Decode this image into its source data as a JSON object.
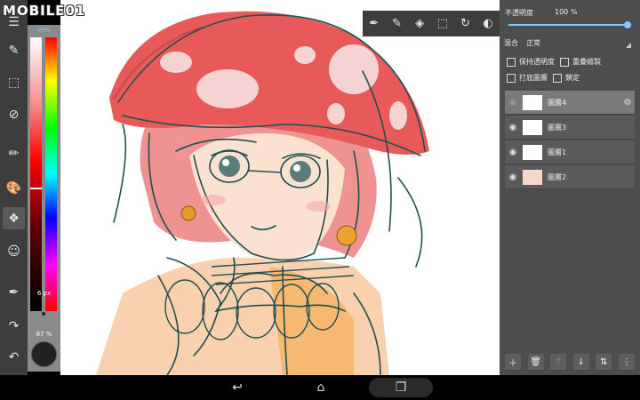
{
  "watermark": {
    "text": "MOBILE01"
  },
  "left_toolbar": {
    "tools": [
      {
        "name": "menu",
        "glyph": "☰"
      },
      {
        "name": "edit",
        "glyph": "✎"
      },
      {
        "name": "select",
        "glyph": "⬚"
      },
      {
        "name": "transform",
        "glyph": "⊘"
      },
      {
        "name": "brush",
        "glyph": "✏"
      },
      {
        "name": "palette",
        "glyph": "🎨"
      },
      {
        "name": "layers",
        "glyph": "❖"
      },
      {
        "name": "smudge",
        "glyph": "☺"
      },
      {
        "name": "eyedropper",
        "glyph": "✒"
      },
      {
        "name": "redo",
        "glyph": "↷"
      },
      {
        "name": "undo",
        "glyph": "↶"
      }
    ]
  },
  "color_panel": {
    "mode": "HSV",
    "brush_size": "6 px",
    "opacity": "87 %",
    "current_color": "#222222"
  },
  "top_toolbar": {
    "tools": [
      "eyedropper-icon",
      "pen-icon",
      "eraser-icon",
      "select-icon",
      "rotate-icon",
      "more-icon"
    ]
  },
  "right_panel": {
    "opacity_label": "不透明度",
    "opacity_value": "100 %",
    "opacity_level": 1.0,
    "blend_label": "混合",
    "blend_value": "正常",
    "checkboxes": {
      "keep_opacity": "保持透明度",
      "clipping": "重疊繪製",
      "draft_layer": "打底圖層",
      "lock": "鎖定"
    },
    "layers": [
      {
        "name": "圖層4",
        "selected": true,
        "visible": false
      },
      {
        "name": "圖層3",
        "selected": false,
        "visible": true
      },
      {
        "name": "圖層1",
        "selected": false,
        "visible": true
      },
      {
        "name": "圖層2",
        "selected": false,
        "visible": true
      }
    ]
  },
  "colors": {
    "panel_bg": "#4d4d4d",
    "toolbar_bg": "#3d3d3d",
    "accent": "#7fc8ff"
  }
}
